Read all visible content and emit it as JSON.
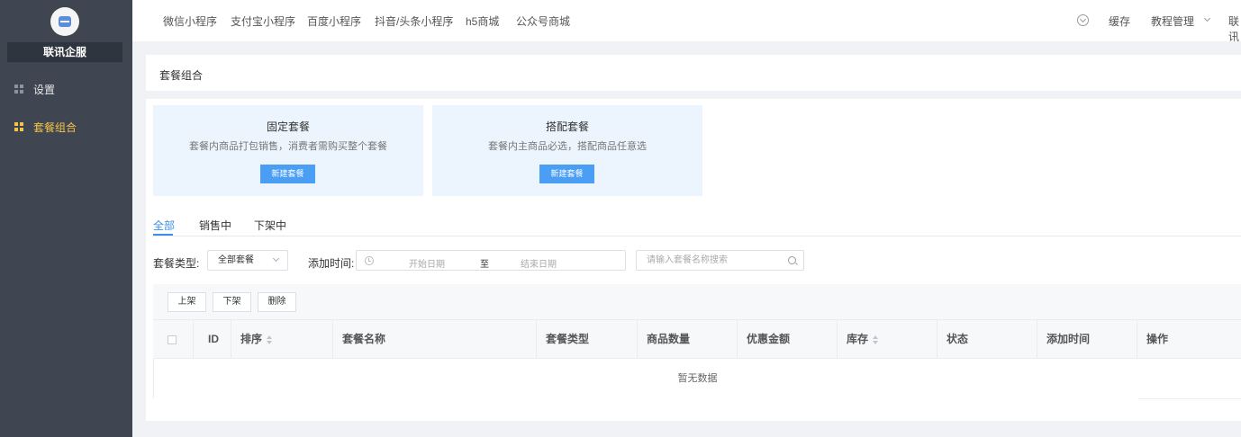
{
  "sidebar": {
    "brand": "联讯企服",
    "items": [
      {
        "label": "设置",
        "icon": "grid-icon",
        "active": false
      },
      {
        "label": "套餐组合",
        "icon": "grid-icon",
        "active": true
      }
    ]
  },
  "header": {
    "tabs": [
      "微信小程序",
      "支付宝小程序",
      "百度小程序",
      "抖音/头条小程序",
      "h5商城",
      "公众号商城"
    ],
    "download_icon": "download-icon",
    "cache": "缓存",
    "tutorial": "教程管理",
    "more": "联讯"
  },
  "page": {
    "title": "套餐组合"
  },
  "packages": [
    {
      "title": "固定套餐",
      "desc": "套餐内商品打包销售，消费者需购买整个套餐",
      "button": "新建套餐"
    },
    {
      "title": "搭配套餐",
      "desc": "套餐内主商品必选，搭配商品任意选",
      "button": "新建套餐"
    }
  ],
  "filter_tabs": {
    "items": [
      "全部",
      "销售中",
      "下架中"
    ],
    "active": 0
  },
  "filters": {
    "type_label": "套餐类型:",
    "type_value": "全部套餐",
    "time_label": "添加时间:",
    "start_placeholder": "开始日期",
    "separator": "至",
    "end_placeholder": "结束日期",
    "search_placeholder": "请输入套餐名称搜索"
  },
  "toolbar": {
    "up": "上架",
    "down": "下架",
    "delete": "删除"
  },
  "table": {
    "columns": [
      "ID",
      "排序",
      "套餐名称",
      "套餐类型",
      "商品数量",
      "优惠金额",
      "库存",
      "状态",
      "添加时间",
      "操作"
    ],
    "empty_text": "暂无数据"
  }
}
